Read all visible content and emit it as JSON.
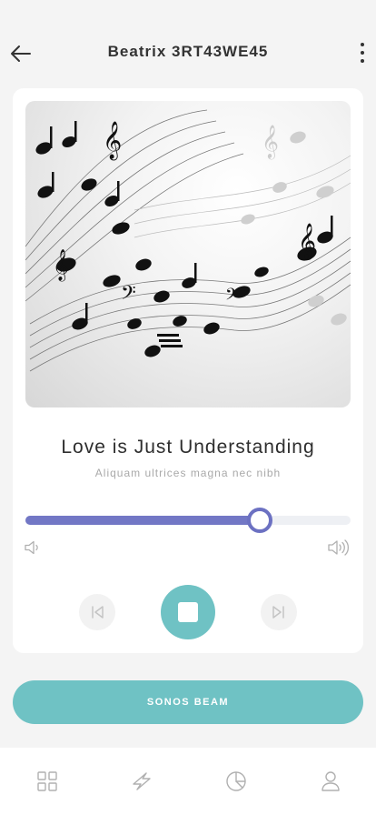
{
  "header": {
    "title": "Beatrix 3RT43WE45",
    "back_icon": "arrow-left-icon",
    "more_icon": "more-vertical-icon"
  },
  "player": {
    "album_art": "music-notes-artwork",
    "song_title": "Love is Just Understanding",
    "song_subtitle": "Aliquam ultrices magna nec nibh",
    "volume_level": 0.72,
    "volume_low_icon": "volume-low-icon",
    "volume_high_icon": "volume-high-icon",
    "controls": {
      "prev_icon": "skip-previous-icon",
      "stop_icon": "stop-icon",
      "next_icon": "skip-next-icon"
    }
  },
  "device_button": {
    "label": "SONOS BEAM"
  },
  "tabbar": {
    "items": [
      {
        "icon": "grid-icon"
      },
      {
        "icon": "bolt-icon"
      },
      {
        "icon": "pie-chart-icon"
      },
      {
        "icon": "user-icon"
      }
    ]
  },
  "colors": {
    "accent_teal": "#6fc2c4",
    "accent_purple": "#7277c5",
    "background": "#f4f4f4",
    "card": "#ffffff"
  }
}
